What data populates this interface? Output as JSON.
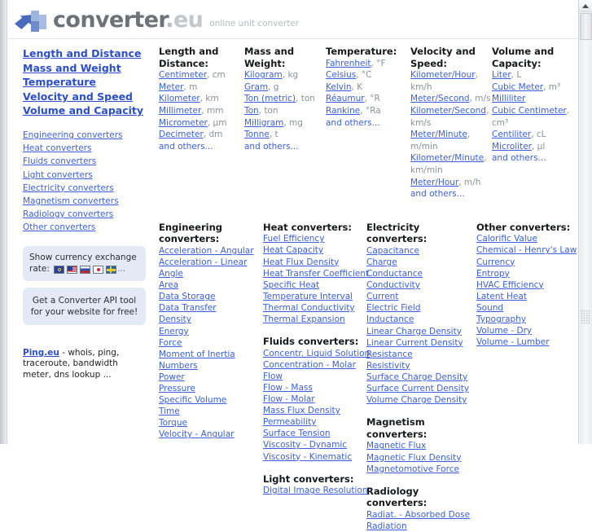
{
  "header": {
    "brand_main": "converter",
    "brand_dot": ".",
    "brand_eu": "eu",
    "tagline": "online unit converter",
    "logo_icon": "arrow-blocks-logo-icon"
  },
  "sidebar": {
    "major_links": [
      "Length and Distance",
      "Mass and Weight",
      "Temperature",
      "Velocity and Speed",
      "Volume and Capacity"
    ],
    "minor_links": [
      "Engineering converters",
      "Heat converters",
      "Fluids converters",
      "Light converters",
      "Electricity converters",
      "Magnetism converters",
      "Radiology converters",
      "Other converters"
    ],
    "currency_promo": {
      "line1": "Show currency exchange",
      "line2": "rate:",
      "flags": [
        "flag-eu",
        "flag-us",
        "flag-ru",
        "flag-jp",
        "flag-se"
      ],
      "more": "..."
    },
    "api_promo": {
      "line1": "Get a Converter API tool",
      "line2": "for your website for free!"
    },
    "ping": {
      "link": "Ping.eu",
      "text": " - whois, ping, traceroute, bandwidth meter, dns lookup ..."
    }
  },
  "top_columns": [
    {
      "title": "Length and Distance:",
      "units": [
        {
          "name": "Centimeter",
          "sym": ", cm"
        },
        {
          "name": "Meter",
          "sym": ", m"
        },
        {
          "name": "Kilometer",
          "sym": ", km"
        },
        {
          "name": "Millimeter",
          "sym": ", mm"
        },
        {
          "name": "Micrometer",
          "sym": ", µm"
        },
        {
          "name": "Decimeter",
          "sym": ", dm"
        }
      ],
      "more": "and others..."
    },
    {
      "title": "Mass and Weight:",
      "units": [
        {
          "name": "Kilogram",
          "sym": ", kg"
        },
        {
          "name": "Gram",
          "sym": ", g"
        },
        {
          "name": "Ton (metric)",
          "sym": ", ton"
        },
        {
          "name": "Ton",
          "sym": ", ton"
        },
        {
          "name": "Milligram",
          "sym": ", mg"
        },
        {
          "name": "Tonne",
          "sym": ", t"
        }
      ],
      "more": "and others..."
    },
    {
      "title": "Temperature:",
      "units": [
        {
          "name": "Fahrenheit",
          "sym": ", °F"
        },
        {
          "name": "Celsius",
          "sym": ", °C"
        },
        {
          "name": "Kelvin",
          "sym": ", K"
        },
        {
          "name": "Réaumur",
          "sym": ", °R"
        },
        {
          "name": "Rankine",
          "sym": ", °Ra"
        }
      ],
      "more": "and others..."
    },
    {
      "title": "Velocity and Speed:",
      "units": [
        {
          "name": "Kilometer/Hour",
          "sym": ", km/h"
        },
        {
          "name": "Meter/Second",
          "sym": ", m/s"
        },
        {
          "name": "Kilometer/Second",
          "sym": ", km/s"
        },
        {
          "name": "Meter/Minute",
          "sym": ", m/min"
        },
        {
          "name": "Kilometer/Minute",
          "sym": ", km/min"
        },
        {
          "name": "Meter/Hour",
          "sym": ", m/h"
        }
      ],
      "more": "and others..."
    },
    {
      "title": "Volume and Capacity:",
      "units": [
        {
          "name": "Liter",
          "sym": ", L"
        },
        {
          "name": "Cubic Meter",
          "sym": ", m³"
        },
        {
          "name": "Milliliter",
          "sym": ""
        },
        {
          "name": "Cubic Centimeter",
          "sym": ", cm³"
        },
        {
          "name": "Centiliter",
          "sym": ", cL"
        },
        {
          "name": "Microliter",
          "sym": ", µl"
        }
      ],
      "more": "and others..."
    }
  ],
  "bottom_columns": [
    {
      "groups": [
        {
          "title": "Engineering converters:",
          "links": [
            "Acceleration - Angular",
            "Acceleration - Linear",
            "Angle",
            "Area",
            "Data Storage",
            "Data Transfer",
            "Density",
            "Energy",
            "Force",
            "Moment of Inertia",
            "Numbers",
            "Power",
            "Pressure",
            "Specific Volume",
            "Time",
            "Torque",
            "Velocity - Angular"
          ]
        }
      ]
    },
    {
      "groups": [
        {
          "title": "Heat converters:",
          "links": [
            "Fuel Efficiency",
            "Heat Capacity",
            "Heat Flux Density",
            "Heat Transfer Coefficient",
            "Specific Heat",
            "Temperature Interval",
            "Thermal Conductivity",
            "Thermal Expansion"
          ]
        },
        {
          "title": "Fluids converters:",
          "links": [
            "Concentr. Liquid Solution",
            "Concentration - Molar",
            "Flow",
            "Flow - Mass",
            "Flow - Molar",
            "Mass Flux Density",
            "Permeability",
            "Surface Tension",
            "Viscosity - Dynamic",
            "Viscosity - Kinematic"
          ]
        },
        {
          "title": "Light converters:",
          "links": [
            "Digital Image Resolution"
          ]
        }
      ]
    },
    {
      "groups": [
        {
          "title": "Electricity converters:",
          "links": [
            "Capacitance",
            "Charge",
            "Conductance",
            "Conductivity",
            "Current",
            "Electric Field",
            "Inductance",
            "Linear Charge Density",
            "Linear Current Density",
            "Resistance",
            "Resistivity",
            "Surface Charge Density",
            "Surface Current Density",
            "Volume Charge Density"
          ]
        },
        {
          "title": "Magnetism converters:",
          "links": [
            "Magnetic Flux",
            "Magnetic Flux Density",
            "Magnetomotive Force"
          ]
        },
        {
          "title": "Radiology converters:",
          "links": [
            "Radiat. - Absorbed Dose",
            "Radiation"
          ]
        }
      ]
    },
    {
      "groups": [
        {
          "title": "Other converters:",
          "links": [
            "Calorific Value",
            "Chemical - Henry's Law",
            "Currency",
            "Entropy",
            "HVAC Efficiency",
            "Latent Heat",
            "Sound",
            "Typography",
            "Volume - Dry",
            "Volume - Lumber"
          ]
        }
      ]
    }
  ],
  "scrollbar": {
    "up_arrow_icon": "scroll-up-arrow-icon"
  },
  "colors": {
    "link": "#3b60dd",
    "link_bold": "#2b4ecb",
    "promo_bg": "#e3e9f5",
    "brand_gray": "#6d7278"
  }
}
